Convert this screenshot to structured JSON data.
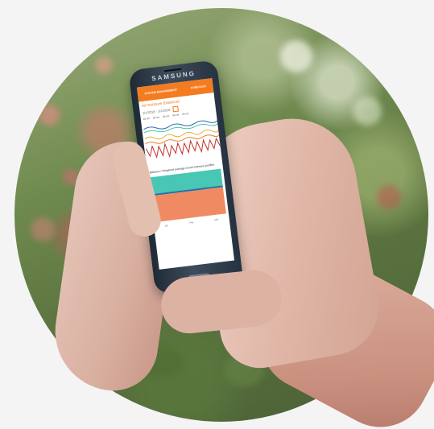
{
  "phone": {
    "brand": "SAMSUNG",
    "app": {
      "tabs": [
        "SYSTEM MANAGEMENT",
        "FORECAST"
      ],
      "title": "oil moisture (balance)",
      "date_range": "1/1/2018 - 1/2/2018",
      "legend": [
        "10 cm",
        "20 cm",
        "30 cm",
        "40 cm",
        "50 cm"
      ],
      "section_title": "Balance / Weighted average of soil moisture profiles",
      "footer": [
        "Jan",
        "Feb",
        "Mar"
      ]
    }
  },
  "colors": {
    "accent": "#f47b20",
    "band_top": "#47c7b4",
    "band_bottom": "#f08a62",
    "band_line": "#2a6ea8"
  }
}
